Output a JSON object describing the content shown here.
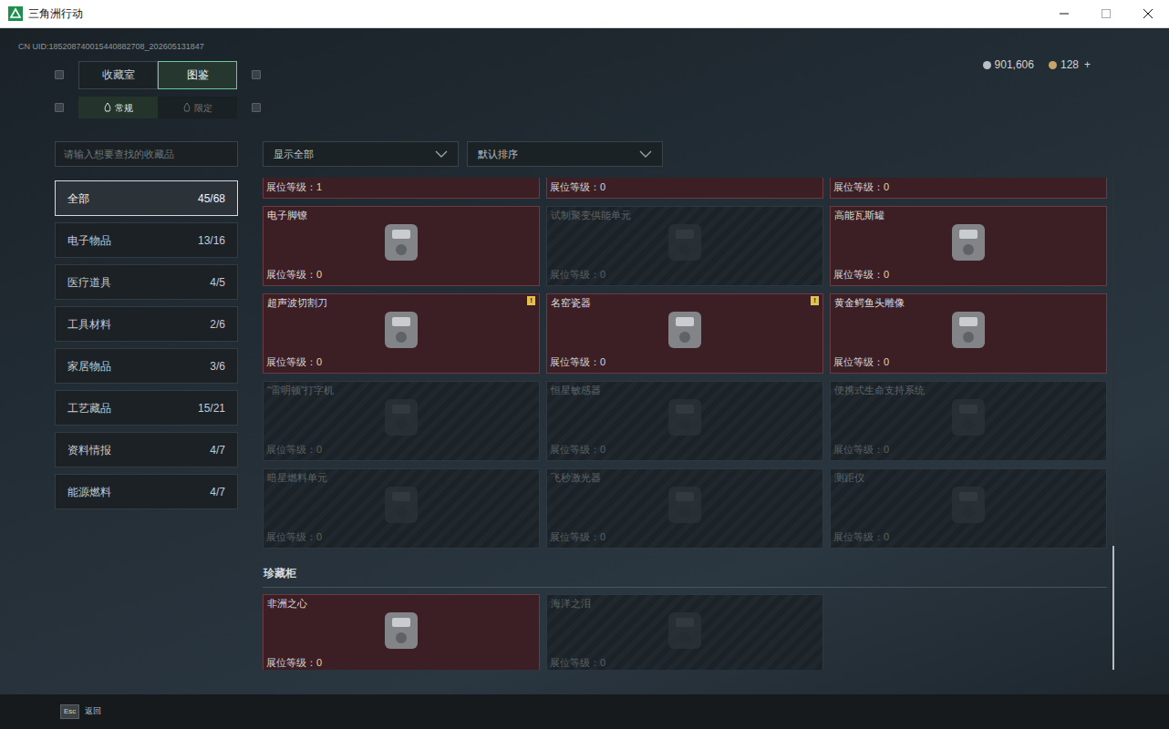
{
  "window": {
    "title": "三角洲行动"
  },
  "uid": "CN UID:185208740015440882708_202605131847",
  "currency": [
    {
      "amount": "901,606"
    },
    {
      "amount": "128",
      "suffix": "+"
    }
  ],
  "tabs": [
    {
      "label": "收藏室",
      "selected": false
    },
    {
      "label": "图鉴",
      "selected": true
    }
  ],
  "subtabs": [
    {
      "label": "常规",
      "selected": true
    },
    {
      "label": "限定",
      "selected": false
    }
  ],
  "search": {
    "placeholder": "请输入想要查找的收藏品"
  },
  "filters": [
    {
      "value": "显示全部"
    },
    {
      "value": "默认排序"
    }
  ],
  "categories": [
    {
      "label": "全部",
      "count": "45/68",
      "selected": true
    },
    {
      "label": "电子物品",
      "count": "13/16",
      "selected": false
    },
    {
      "label": "医疗道具",
      "count": "4/5",
      "selected": false
    },
    {
      "label": "工具材料",
      "count": "2/6",
      "selected": false
    },
    {
      "label": "家居物品",
      "count": "3/6",
      "selected": false
    },
    {
      "label": "工艺藏品",
      "count": "15/21",
      "selected": false
    },
    {
      "label": "资料情报",
      "count": "4/7",
      "selected": false
    },
    {
      "label": "能源燃料",
      "count": "4/7",
      "selected": false
    }
  ],
  "grid": {
    "items": [
      {
        "level": "展位等级：1",
        "owned": true
      },
      {
        "level": "展位等级：0",
        "owned": true
      },
      {
        "level": "展位等级：0",
        "owned": true
      },
      {
        "name": "电子脚镣",
        "level": "展位等级：0",
        "owned": true
      },
      {
        "name": "试制聚变供能单元",
        "level": "展位等级：0",
        "owned": false
      },
      {
        "name": "高能瓦斯罐",
        "level": "展位等级：0",
        "owned": true
      },
      {
        "name": "超声波切割刀",
        "level": "展位等级：0",
        "owned": true,
        "badge": "!"
      },
      {
        "name": "名窑瓷器",
        "level": "展位等级：0",
        "owned": true,
        "badge": "!"
      },
      {
        "name": "黄金鳄鱼头雕像",
        "level": "展位等级：0",
        "owned": true
      },
      {
        "name": "“雷明顿”打字机",
        "level": "展位等级：0",
        "owned": false
      },
      {
        "name": "恒星敏感器",
        "level": "展位等级：0",
        "owned": false
      },
      {
        "name": "便携式生命支持系统",
        "level": "展位等级：0",
        "owned": false
      },
      {
        "name": "暗星燃料单元",
        "level": "展位等级：0",
        "owned": false
      },
      {
        "name": "飞秒激光器",
        "level": "展位等级：0",
        "owned": false
      },
      {
        "name": "测距仪",
        "level": "展位等级：0",
        "owned": false
      }
    ]
  },
  "cabinet": {
    "title": "珍藏柜",
    "items": [
      {
        "name": "非洲之心",
        "level": "展位等级：0",
        "owned": true
      },
      {
        "name": "海洋之泪",
        "level": "展位等级：0",
        "owned": false
      }
    ]
  },
  "scrollbar": {
    "level": 1
  },
  "footer": {
    "key": "Esc",
    "label": "返回"
  }
}
